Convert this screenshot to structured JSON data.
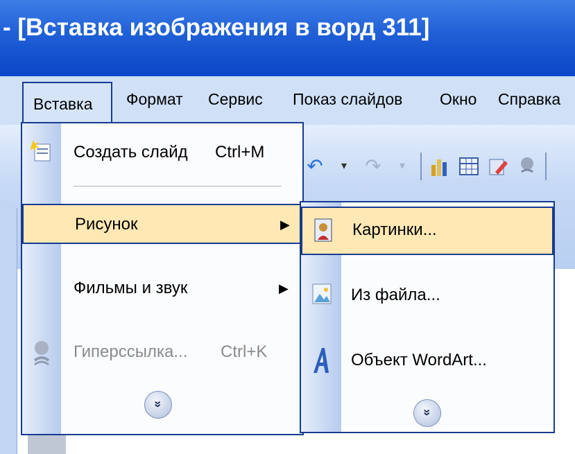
{
  "title": "- [Вставка изображения в ворд 311]",
  "menubar": {
    "items": [
      "Вставка",
      "Формат",
      "Сервис",
      "Показ слайдов",
      "Окно",
      "Справка"
    ],
    "underline": [
      "а",
      "м",
      "е",
      "д",
      "О",
      "С"
    ]
  },
  "toolbar": {
    "icons": [
      "undo-icon",
      "redo-icon",
      "chart-icon",
      "table-icon",
      "edit-icon",
      "hyperlink-icon"
    ]
  },
  "insert_menu": {
    "new_slide": {
      "label": "Создать слайд",
      "shortcut": "Ctrl+M"
    },
    "picture": {
      "label": "Рисунок"
    },
    "movies": {
      "label": "Фильмы и звук"
    },
    "hyperlink": {
      "label": "Гиперссылка...",
      "shortcut": "Ctrl+K",
      "enabled": false
    },
    "expand_label": "»"
  },
  "picture_submenu": {
    "clipart": {
      "label": "Картинки..."
    },
    "from_file": {
      "label": "Из файла..."
    },
    "wordart": {
      "label": "Объект WordArt..."
    },
    "expand_label": "»"
  }
}
